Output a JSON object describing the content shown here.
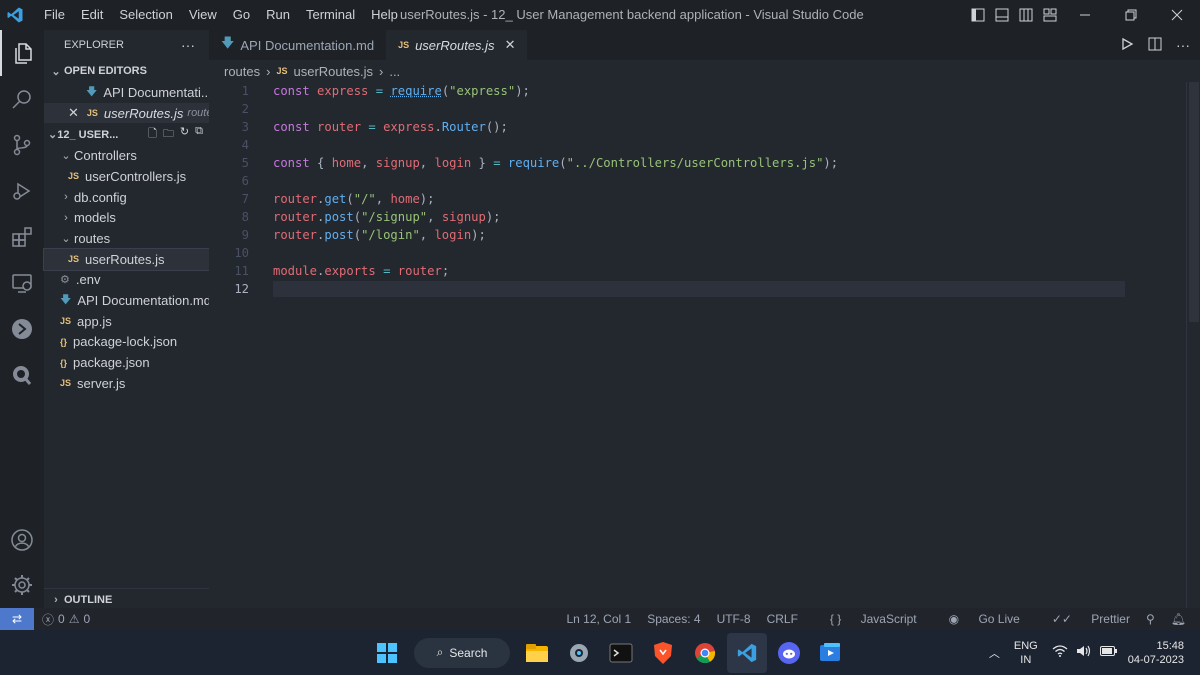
{
  "window": {
    "title": "userRoutes.js - 12_ User Management backend application - Visual Studio Code",
    "menu": [
      "File",
      "Edit",
      "Selection",
      "View",
      "Go",
      "Run",
      "Terminal",
      "Help"
    ]
  },
  "sidebar": {
    "header": "EXPLORER",
    "open_editors_label": "OPEN EDITORS",
    "open_editors": [
      {
        "name": "API Documentati...",
        "badge": "",
        "hint": ""
      },
      {
        "name": "userRoutes.js",
        "badge": "JS",
        "hint": "routes"
      }
    ],
    "folder_label": "12_ USER...",
    "tree": [
      {
        "name": "Controllers",
        "type": "folder-open"
      },
      {
        "name": "userControllers.js",
        "badge": "JS"
      },
      {
        "name": "db.config",
        "type": "folder"
      },
      {
        "name": "models",
        "type": "folder"
      },
      {
        "name": "routes",
        "type": "folder-open"
      },
      {
        "name": "userRoutes.js",
        "badge": "JS"
      },
      {
        "name": ".env",
        "icon": "gear-icon"
      },
      {
        "name": "API Documentation.md",
        "icon": "download-arrow-icon"
      },
      {
        "name": "app.js",
        "badge": "JS"
      },
      {
        "name": "package-lock.json",
        "badge": "{}"
      },
      {
        "name": "package.json",
        "badge": "{}"
      },
      {
        "name": "server.js",
        "badge": "JS"
      }
    ],
    "outline_label": "OUTLINE"
  },
  "tabs": [
    {
      "label": "API Documentation.md",
      "active": false
    },
    {
      "label": "userRoutes.js",
      "badge": "JS",
      "active": true
    }
  ],
  "breadcrumb": [
    "routes",
    "JS",
    "userRoutes.js",
    "..."
  ],
  "editor": {
    "lines": [
      {
        "n": "1",
        "text": "const express = require(\"express\");"
      },
      {
        "n": "2",
        "text": ""
      },
      {
        "n": "3",
        "text": "const router = express.Router();"
      },
      {
        "n": "4",
        "text": ""
      },
      {
        "n": "5",
        "text": "const { home, signup, login } = require(\"../Controllers/userControllers.js\");"
      },
      {
        "n": "6",
        "text": ""
      },
      {
        "n": "7",
        "text": "router.get(\"/\", home);"
      },
      {
        "n": "8",
        "text": "router.post(\"/signup\", signup);"
      },
      {
        "n": "9",
        "text": "router.post(\"/login\", login);"
      },
      {
        "n": "10",
        "text": ""
      },
      {
        "n": "11",
        "text": "module.exports = router;"
      },
      {
        "n": "12",
        "text": ""
      }
    ]
  },
  "status": {
    "errors": "0",
    "warnings": "0",
    "position": "Ln 12, Col 1",
    "spaces": "Spaces: 4",
    "encoding": "UTF-8",
    "eol": "CRLF",
    "language": "JavaScript",
    "live": "Go Live",
    "prettier": "Prettier"
  },
  "taskbar": {
    "search_label": "Search",
    "lang_top": "ENG",
    "lang_bottom": "IN",
    "time": "15:48",
    "date": "04-07-2023"
  },
  "colors": {
    "accent": "#4d78cc",
    "keyword": "#c678dd",
    "variable": "#e06c75",
    "function": "#61afef",
    "string": "#98c379"
  }
}
